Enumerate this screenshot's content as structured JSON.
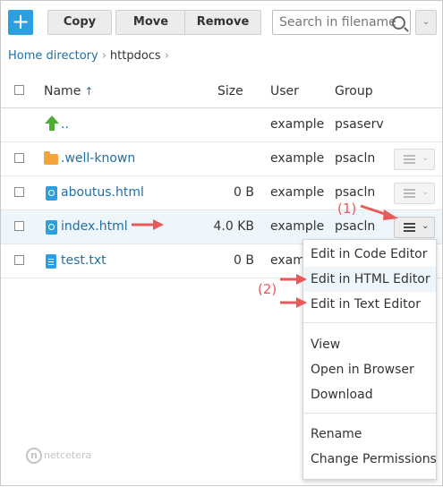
{
  "toolbar": {
    "add_label": "+",
    "copy_label": "Copy",
    "move_label": "Move",
    "remove_label": "Remove"
  },
  "search": {
    "placeholder": "Search in filename"
  },
  "breadcrumb": {
    "items": [
      "Home directory",
      "httpdocs"
    ]
  },
  "table": {
    "headers": {
      "name": "Name",
      "size": "Size",
      "user": "User",
      "group": "Group"
    },
    "rows": [
      {
        "name": "..",
        "size": "",
        "user": "example",
        "group": "psaserv",
        "icon": "up-arrow-icon"
      },
      {
        "name": ".well-known",
        "size": "",
        "user": "example",
        "group": "psacln",
        "icon": "folder-icon"
      },
      {
        "name": "aboutus.html",
        "size": "0 B",
        "user": "example",
        "group": "psacln",
        "icon": "html-file-icon"
      },
      {
        "name": "index.html",
        "size": "4.0 KB",
        "user": "example",
        "group": "psacln",
        "icon": "html-file-icon"
      },
      {
        "name": "test.txt",
        "size": "0 B",
        "user": "exam",
        "group": "",
        "icon": "text-file-icon"
      }
    ]
  },
  "context_menu": {
    "items": [
      "Edit in Code Editor",
      "Edit in HTML Editor",
      "Edit in Text Editor",
      "View",
      "Open in Browser",
      "Download",
      "Rename",
      "Change Permissions"
    ]
  },
  "annotations": {
    "one": "(1)",
    "two": "(2)",
    "color": "#ea5a5a"
  },
  "logo": {
    "text": "netcetera"
  },
  "colors": {
    "accent": "#2b9fe0",
    "link": "#1f6fa6"
  }
}
